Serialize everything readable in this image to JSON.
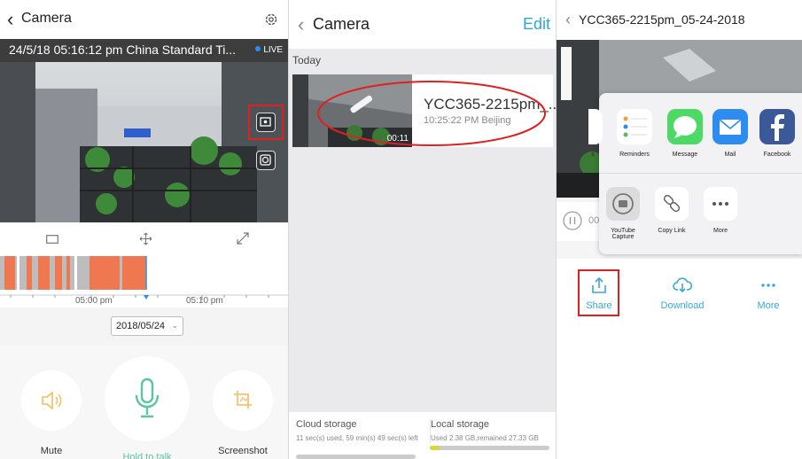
{
  "panel1": {
    "title": "Camera",
    "timestamp": "24/5/18 05:16:12 pm China Standard Ti...",
    "live_label": "LIVE",
    "tick_labels": [
      "05:00 pm",
      "05:10 pm"
    ],
    "date": "2018/05/24",
    "actions": {
      "mute": "Mute",
      "talk": "Hold to talk",
      "screenshot": "Screenshot"
    },
    "colors": {
      "accent_green": "#5cc4a0",
      "timeline_orange": "#f07850",
      "ring": "#fbe8c8"
    }
  },
  "panel2": {
    "title": "Camera",
    "edit": "Edit",
    "section": "Today",
    "recording": {
      "name": "YCC365-2215pm_...",
      "time": "10:25:22 PM Beijing",
      "duration": "00:11"
    },
    "storage": {
      "cloud_title": "Cloud storage",
      "cloud_text": "11 sec(s) used, 59 min(s) 49 sec(s) left",
      "local_title": "Local storage",
      "local_text": "Used 2.38 GB,remained 27.33 GB",
      "local_used_fraction": 0.08
    }
  },
  "panel3": {
    "title": "YCC365-2215pm_05-24-2018",
    "elapsed": "00",
    "share_apps": [
      {
        "label": "s",
        "icon": "notes-icon"
      },
      {
        "label": "Reminders",
        "icon": "reminders-icon"
      },
      {
        "label": "Message",
        "icon": "message-icon"
      },
      {
        "label": "Mail",
        "icon": "mail-icon"
      },
      {
        "label": "Facebook",
        "icon": "facebook-icon"
      }
    ],
    "share_actions": [
      {
        "label": "YouTube Capture",
        "icon": "youtube-capture-icon"
      },
      {
        "label": "Copy Link",
        "icon": "link-icon"
      },
      {
        "label": "More",
        "icon": "more-dots-icon"
      }
    ],
    "actions": {
      "share": "Share",
      "download": "Download",
      "more": "More"
    },
    "colors": {
      "action_blue": "#3aa8d8",
      "highlight_red": "#e02020"
    }
  }
}
